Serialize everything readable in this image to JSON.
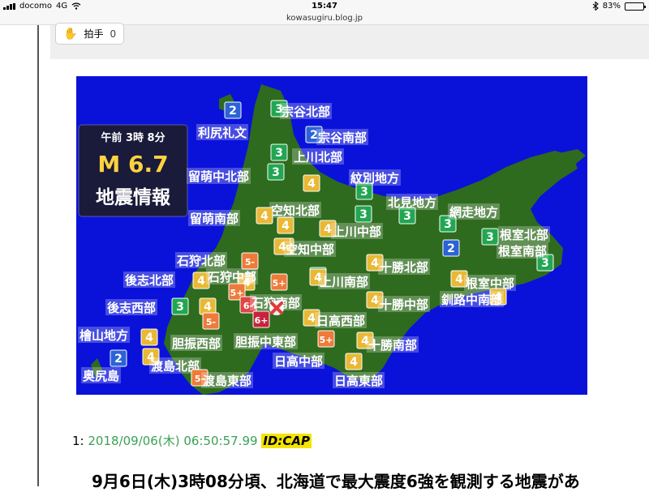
{
  "status": {
    "carrier": "docomo",
    "network": "4G",
    "time": "15:47",
    "battery": "83%",
    "battery_level": 0.83,
    "bluetooth_icon": "bluetooth-icon"
  },
  "url": "kowasugiru.blog.jp",
  "clap": {
    "label": "拍手",
    "count": "0",
    "icon": "clap-icon"
  },
  "map": {
    "info_box": {
      "time": "午前 3時 8分",
      "magnitude": "M 6.7",
      "title": "地震情報"
    },
    "colors": {
      "sea": "#0a12d9",
      "land": "#2e6b1e",
      "int2": "#2b63d6",
      "int3": "#22a652",
      "int4": "#e9b834",
      "int5p": "#ee7b3a",
      "int6m": "#e04545",
      "int6p": "#c9223a"
    },
    "markers": [
      {
        "t": "2",
        "c": "int2",
        "label": "利尻礼文"
      },
      {
        "t": "3",
        "c": "int3",
        "label": "宗谷北部"
      },
      {
        "t": "2",
        "c": "int2",
        "label": "宗谷南部"
      },
      {
        "t": "3",
        "c": "int3",
        "label": "上川北部"
      },
      {
        "t": "3",
        "c": "int3",
        "label": "留萌中北部"
      },
      {
        "t": "4",
        "c": "int4",
        "label": ""
      },
      {
        "t": "3",
        "c": "int3",
        "label": "紋別地方"
      },
      {
        "t": "3",
        "c": "int3",
        "label": ""
      },
      {
        "t": "4",
        "c": "int4",
        "label": "空知北部"
      },
      {
        "t": "4",
        "c": "int4",
        "label": "留萌南部"
      },
      {
        "t": "4",
        "c": "int4",
        "label": ""
      },
      {
        "t": "4",
        "c": "int4",
        "label": "上川中部"
      },
      {
        "t": "3",
        "c": "int3",
        "label": "北見地方"
      },
      {
        "t": "3",
        "c": "int3",
        "label": "網走地方"
      },
      {
        "t": "3",
        "c": "int3",
        "label": "根室北部"
      },
      {
        "t": "2",
        "c": "int2",
        "label": ""
      },
      {
        "t": "3",
        "c": "int3",
        "label": "根室南部"
      },
      {
        "t": "4",
        "c": "int4",
        "label": "空知中部"
      },
      {
        "t": "5-",
        "c": "int5p",
        "label": "石狩北部"
      },
      {
        "t": "4",
        "c": "int4",
        "label": "十勝北部"
      },
      {
        "t": "3",
        "c": "int3",
        "label": ""
      },
      {
        "t": "4",
        "c": "int4",
        "label": "後志北部"
      },
      {
        "t": "4",
        "c": "int4",
        "label": "石狩中部"
      },
      {
        "t": "5+",
        "c": "int5p",
        "label": ""
      },
      {
        "t": "4",
        "c": "int4",
        "label": "上川南部"
      },
      {
        "t": "4",
        "c": "int4",
        "label": "根室中部"
      },
      {
        "t": "5+",
        "c": "int5p",
        "label": ""
      },
      {
        "t": "3",
        "c": "int3",
        "label": "後志西部"
      },
      {
        "t": "4",
        "c": "int4",
        "label": ""
      },
      {
        "t": "6-",
        "c": "int6m",
        "label": "石狩南部"
      },
      {
        "t": "4",
        "c": "int4",
        "label": "十勝中部"
      },
      {
        "t": "4",
        "c": "int4",
        "label": "釧路中南部"
      },
      {
        "t": "6+",
        "c": "int6p",
        "label": ""
      },
      {
        "t": "4",
        "c": "int4",
        "label": "日高西部"
      },
      {
        "t": "5-",
        "c": "int5p",
        "label": "胆振西部"
      },
      {
        "t": "4",
        "c": "int4",
        "label": "檜山地方"
      },
      {
        "t": "5+",
        "c": "int5p",
        "label": "胆振中東部"
      },
      {
        "t": "4",
        "c": "int4",
        "label": "十勝南部"
      },
      {
        "t": "2",
        "c": "int2",
        "label": "奥尻島"
      },
      {
        "t": "4",
        "c": "int4",
        "label": "渡島北部"
      },
      {
        "t": "4",
        "c": "int4",
        "label": "日高中部"
      },
      {
        "t": "5-",
        "c": "int5p",
        "label": "渡島東部"
      },
      {
        "t": "",
        "c": "",
        "label": "日高東部"
      }
    ]
  },
  "post": {
    "number": "1:",
    "date": "2018/09/06(木) 06:50:57.99",
    "id": "ID:CAP",
    "text": "9月6日(木)3時08分頃、北海道で最大震度6強を観測する地震があ"
  }
}
